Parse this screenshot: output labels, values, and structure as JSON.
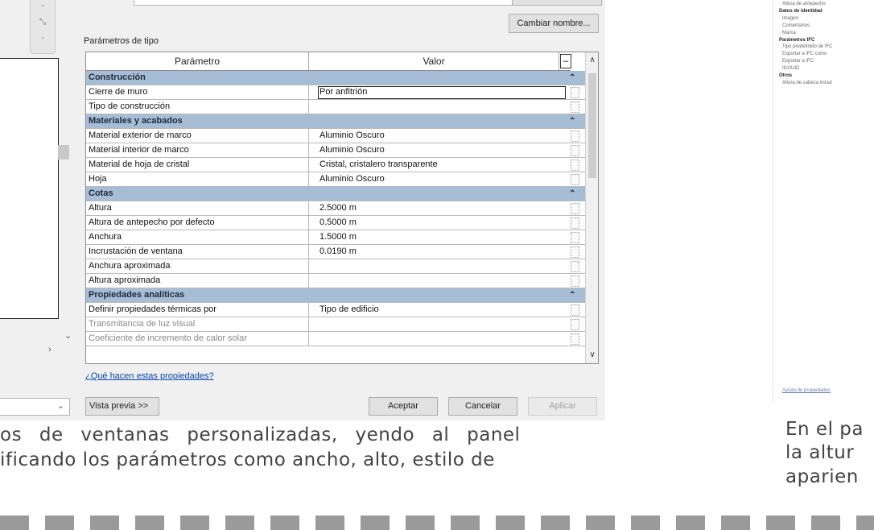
{
  "left_pane": {
    "zoom_tools": [
      "-",
      "⤡",
      "-"
    ],
    "nav_arrow_down": "⌄",
    "nav_arrow_right": "›",
    "combo_arrow": "⌄"
  },
  "dialog": {
    "rename_button": "Cambiar nombre...",
    "params_label": "Parámetros de tipo",
    "header": {
      "param": "Parámetro",
      "value": "Valor",
      "collapse": "–"
    },
    "rows": [
      {
        "type": "group",
        "name": "Construcción"
      },
      {
        "type": "param",
        "name": "Cierre de muro",
        "value": "Por anfitrión",
        "editing": true
      },
      {
        "type": "param",
        "name": "Tipo de construcción",
        "value": ""
      },
      {
        "type": "group",
        "name": "Materiales y acabados"
      },
      {
        "type": "param",
        "name": "Material exterior de marco",
        "value": "Aluminio Oscuro"
      },
      {
        "type": "param",
        "name": "Material interior de marco",
        "value": "Aluminio Oscuro"
      },
      {
        "type": "param",
        "name": "Material de hoja de cristal",
        "value": "Cristal, cristalero transparente"
      },
      {
        "type": "param",
        "name": "Hoja",
        "value": "Aluminio Oscuro"
      },
      {
        "type": "group",
        "name": "Cotas"
      },
      {
        "type": "param",
        "name": "Altura",
        "value": "2.5000 m"
      },
      {
        "type": "param",
        "name": "Altura de antepecho por defecto",
        "value": "0.5000 m"
      },
      {
        "type": "param",
        "name": "Anchura",
        "value": "1.5000 m"
      },
      {
        "type": "param",
        "name": "Incrustación de ventana",
        "value": "0.0190 m"
      },
      {
        "type": "param",
        "name": "Anchura aproximada",
        "value": ""
      },
      {
        "type": "param",
        "name": "Altura aproximada",
        "value": ""
      },
      {
        "type": "group",
        "name": "Propiedades analíticas"
      },
      {
        "type": "param",
        "name": "Definir propiedades térmicas por",
        "value": "Tipo de edificio"
      },
      {
        "type": "param",
        "name": "Transmitancia de luz visual",
        "value": "",
        "disabled": true
      },
      {
        "type": "param",
        "name": "Coeficiente de incremento de calor solar",
        "value": "",
        "disabled": true
      }
    ],
    "scroll_up": "∧",
    "scroll_down": "∨",
    "help_link": "¿Qué hacen estas propiedades?",
    "preview_button": "Vista previa >>",
    "ok_button": "Aceptar",
    "cancel_button": "Cancelar",
    "apply_button": "Aplicar"
  },
  "caption_left": {
    "line1": "os de ventanas personalizadas, yendo al panel",
    "line2": "ificando los parámetros como ancho, alto, estilo de"
  },
  "right_panel": {
    "items": [
      {
        "text": "Altura de antepecho",
        "kind": "item"
      },
      {
        "text": "Datos de identidad",
        "kind": "group"
      },
      {
        "text": "Imagen",
        "kind": "item"
      },
      {
        "text": "Comentarios",
        "kind": "item"
      },
      {
        "text": "Marca",
        "kind": "item"
      },
      {
        "text": "Parámetros IFC",
        "kind": "group"
      },
      {
        "text": "Tipo predefinido de IFC",
        "kind": "item"
      },
      {
        "text": "Exportar a IFC como",
        "kind": "item"
      },
      {
        "text": "Exportar a IFC",
        "kind": "item"
      },
      {
        "text": "IfcGUID",
        "kind": "item"
      },
      {
        "text": "Otros",
        "kind": "group"
      },
      {
        "text": "Altura de cabeza inicial",
        "kind": "item"
      }
    ],
    "help_link": "Ayuda de propiedades",
    "caption": [
      "En el pa",
      "la altur",
      "aparien"
    ]
  },
  "colors": {
    "group_row": "#a7bdd6",
    "dialog_bg": "#f0f0f0",
    "link": "#0645ad"
  }
}
